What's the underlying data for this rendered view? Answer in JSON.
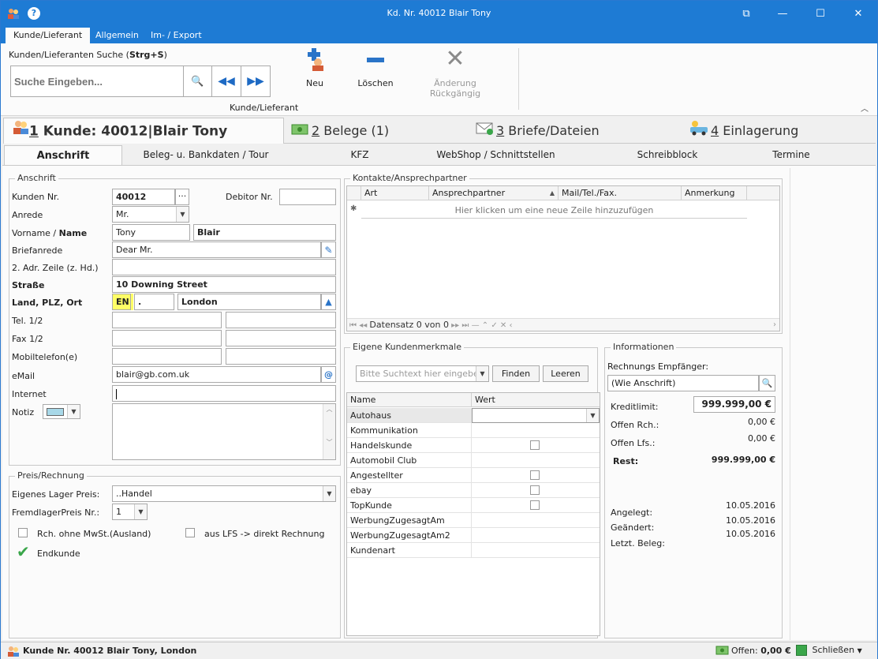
{
  "window": {
    "title": "Kd. Nr. 40012 Blair Tony"
  },
  "ribbon": {
    "tabs": [
      "Kunde/Lieferant",
      "Allgemein",
      "Im- / Export"
    ],
    "search_label_prefix": "Kunden/Lieferanten Suche (",
    "search_label_shortcut": "Strg+S",
    "search_label_suffix": ")",
    "search_placeholder": "Suche Eingeben...",
    "btn_new": "Neu",
    "btn_delete": "Löschen",
    "btn_undo": "Änderung Rückgängig",
    "group_label": "Kunde/Lieferant"
  },
  "main_tabs": [
    {
      "num": "1",
      "label": " Kunde: 40012|Blair Tony"
    },
    {
      "num": "2",
      "label": " Belege (1)"
    },
    {
      "num": "3",
      "label": " Briefe/Dateien"
    },
    {
      "num": "4",
      "label": " Einlagerung"
    }
  ],
  "sub_tabs": [
    "Anschrift",
    "Beleg- u. Bankdaten / Tour",
    "KFZ",
    "WebShop / Schnittstellen",
    "Schreibblock",
    "Termine"
  ],
  "anschrift": {
    "title": "Anschrift",
    "kunden_nr_label": "Kunden Nr.",
    "kunden_nr": "40012",
    "debitor_label": "Debitor Nr.",
    "debitor": "",
    "anrede_label": "Anrede",
    "anrede": "Mr.",
    "vorname_label": "Vorname / ",
    "name_label": "Name",
    "vorname": "Tony",
    "name": "Blair",
    "briefanrede_label": "Briefanrede",
    "briefanrede": "Dear Mr.",
    "adr2_label": "2. Adr. Zeile (z. Hd.)",
    "adr2": "",
    "strasse_label": "Straße",
    "strasse": "10 Downing Street",
    "land_label": "Land, PLZ, Ort",
    "land": "EN",
    "plz": ".",
    "ort": "London",
    "tel_label": "Tel. 1/2",
    "fax_label": "Fax 1/2",
    "mobil_label": "Mobiltelefon(e)",
    "email_label": "eMail",
    "email": "blair@gb.com.uk",
    "internet_label": "Internet",
    "notiz_label": "Notiz"
  },
  "kontakte": {
    "title": "Kontakte/Ansprechpartner",
    "columns": [
      "Art",
      "Ansprechpartner",
      "Mail/Tel./Fax.",
      "Anmerkung"
    ],
    "new_row_hint": "Hier klicken um eine neue Zeile hinzuzufügen",
    "nav_text": "Datensatz 0 von 0"
  },
  "merkmale": {
    "title": "Eigene Kundenmerkmale",
    "search_placeholder": "Bitte Suchtext hier eingeben...",
    "find_btn": "Finden",
    "clear_btn": "Leeren",
    "columns": [
      "Name",
      "Wert"
    ],
    "rows": [
      {
        "name": "Autohaus",
        "type": "combo"
      },
      {
        "name": "Kommunikation",
        "type": "text"
      },
      {
        "name": "Handelskunde",
        "type": "check"
      },
      {
        "name": "Automobil Club",
        "type": "text"
      },
      {
        "name": "Angestellter",
        "type": "check"
      },
      {
        "name": "ebay",
        "type": "check"
      },
      {
        "name": "TopKunde",
        "type": "check"
      },
      {
        "name": "WerbungZugesagtAm",
        "type": "text"
      },
      {
        "name": "WerbungZugesagtAm2",
        "type": "text"
      },
      {
        "name": "Kundenart",
        "type": "text"
      }
    ]
  },
  "info": {
    "title": "Informationen",
    "empfaenger_label": "Rechnungs Empfänger:",
    "empfaenger": "(Wie Anschrift)",
    "kreditlimit_label": "Kreditlimit:",
    "kreditlimit": "999.999,00 €",
    "offen_rch_label": "Offen Rch.:",
    "offen_rch": "0,00 €",
    "offen_lfs_label": "Offen Lfs.:",
    "offen_lfs": "0,00 €",
    "rest_label": "Rest:",
    "rest": "999.999,00 €",
    "angelegt_label": "Angelegt:",
    "angelegt": "10.05.2016",
    "geaendert_label": "Geändert:",
    "geaendert": "10.05.2016",
    "letzt_label": "Letzt. Beleg:",
    "letzt": "10.05.2016"
  },
  "preis": {
    "title": "Preis/Rechnung",
    "lager_label": "Eigenes Lager Preis:",
    "lager": "..Handel",
    "fremd_label": "FremdlagerPreis Nr.:",
    "fremd": "1",
    "ohne_mwst_label": "Rch. ohne MwSt.(Ausland)",
    "lfs_label": "aus LFS -> direkt Rechnung",
    "endkunde_label": "Endkunde"
  },
  "status": {
    "text": "Kunde Nr. 40012 Blair Tony, London",
    "offen_label": "Offen: ",
    "offen_value": "0,00 €",
    "close_label": "Schließen"
  },
  "colors": {
    "accent": "#1e7bd4",
    "highlight": "#ffff66"
  }
}
